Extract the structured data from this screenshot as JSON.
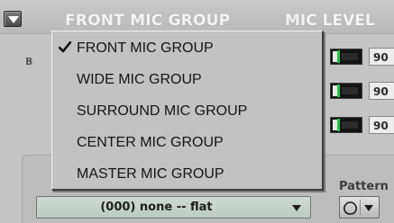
{
  "header": {
    "title": "FRONT MIC GROUP",
    "level_label": "MIC LEVEL",
    "row_label": "B"
  },
  "levels": [
    {
      "value": "90"
    },
    {
      "value": "90"
    },
    {
      "value": "90"
    }
  ],
  "menu": {
    "items": [
      {
        "label": "FRONT MIC GROUP",
        "checked": true
      },
      {
        "label": "WIDE MIC GROUP",
        "checked": false
      },
      {
        "label": "SURROUND MIC GROUP",
        "checked": false
      },
      {
        "label": "CENTER MIC GROUP",
        "checked": false
      },
      {
        "label": "MASTER MIC GROUP",
        "checked": false
      }
    ]
  },
  "pattern": {
    "label": "Pattern"
  },
  "preset": {
    "value": "(000) none -- flat"
  },
  "icons": {
    "header_dropdown": "triangle-down-icon",
    "menu_check": "checkmark-icon",
    "preset_arrow": "triangle-down-icon",
    "pattern_icon": "polar-pattern-icon",
    "pattern_caret": "triangle-down-icon"
  },
  "colors": {
    "meter_indicator": "#27c44a",
    "preset_field": "#c7d3cc"
  }
}
